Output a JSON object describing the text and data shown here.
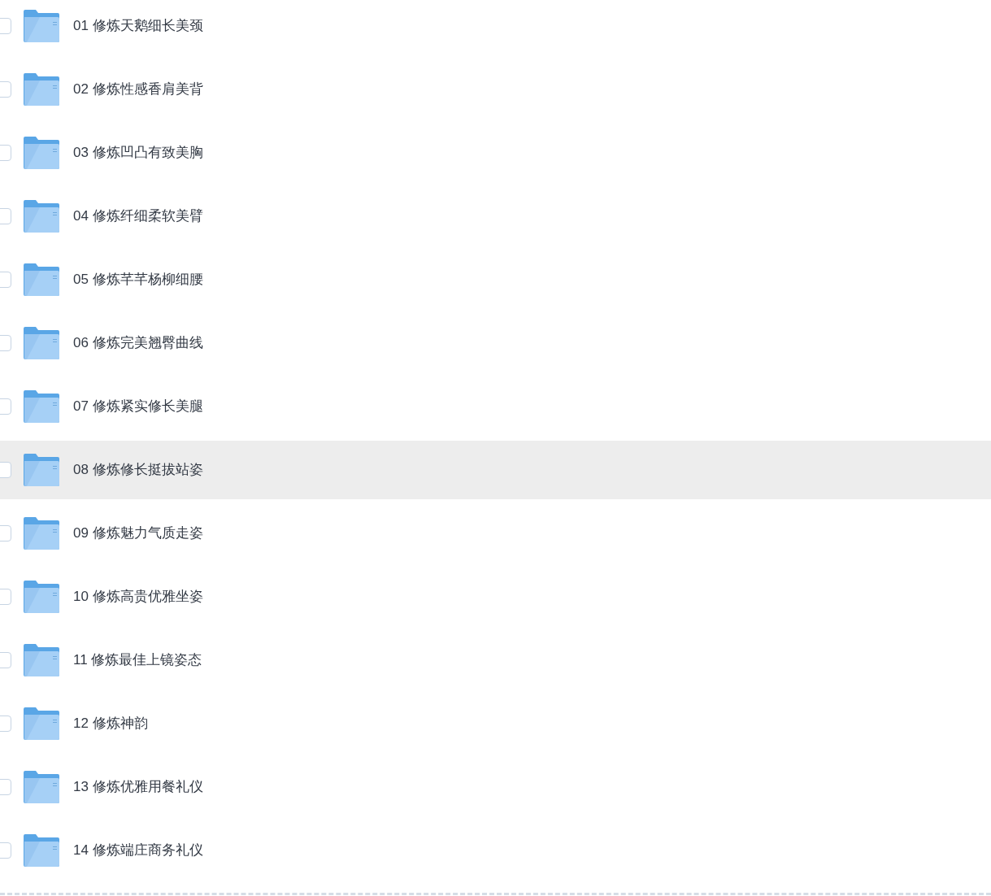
{
  "files": [
    {
      "name": "01 修炼天鹅细长美颈",
      "checked": false,
      "selected": false
    },
    {
      "name": "02 修炼性感香肩美背",
      "checked": false,
      "selected": false
    },
    {
      "name": "03 修炼凹凸有致美胸",
      "checked": false,
      "selected": false
    },
    {
      "name": "04 修炼纤细柔软美臂",
      "checked": false,
      "selected": false
    },
    {
      "name": "05 修炼芊芊杨柳细腰",
      "checked": false,
      "selected": false
    },
    {
      "name": "06 修炼完美翘臀曲线",
      "checked": false,
      "selected": false
    },
    {
      "name": "07 修炼紧实修长美腿",
      "checked": false,
      "selected": false
    },
    {
      "name": "08 修炼修长挺拔站姿",
      "checked": false,
      "selected": true
    },
    {
      "name": "09 修炼魅力气质走姿",
      "checked": false,
      "selected": false
    },
    {
      "name": "10 修炼高贵优雅坐姿",
      "checked": false,
      "selected": false
    },
    {
      "name": "11 修炼最佳上镜姿态",
      "checked": false,
      "selected": false
    },
    {
      "name": "12 修炼神韵",
      "checked": false,
      "selected": false
    },
    {
      "name": "13 修炼优雅用餐礼仪",
      "checked": false,
      "selected": false
    },
    {
      "name": "14 修炼端庄商务礼仪",
      "checked": false,
      "selected": false
    }
  ]
}
